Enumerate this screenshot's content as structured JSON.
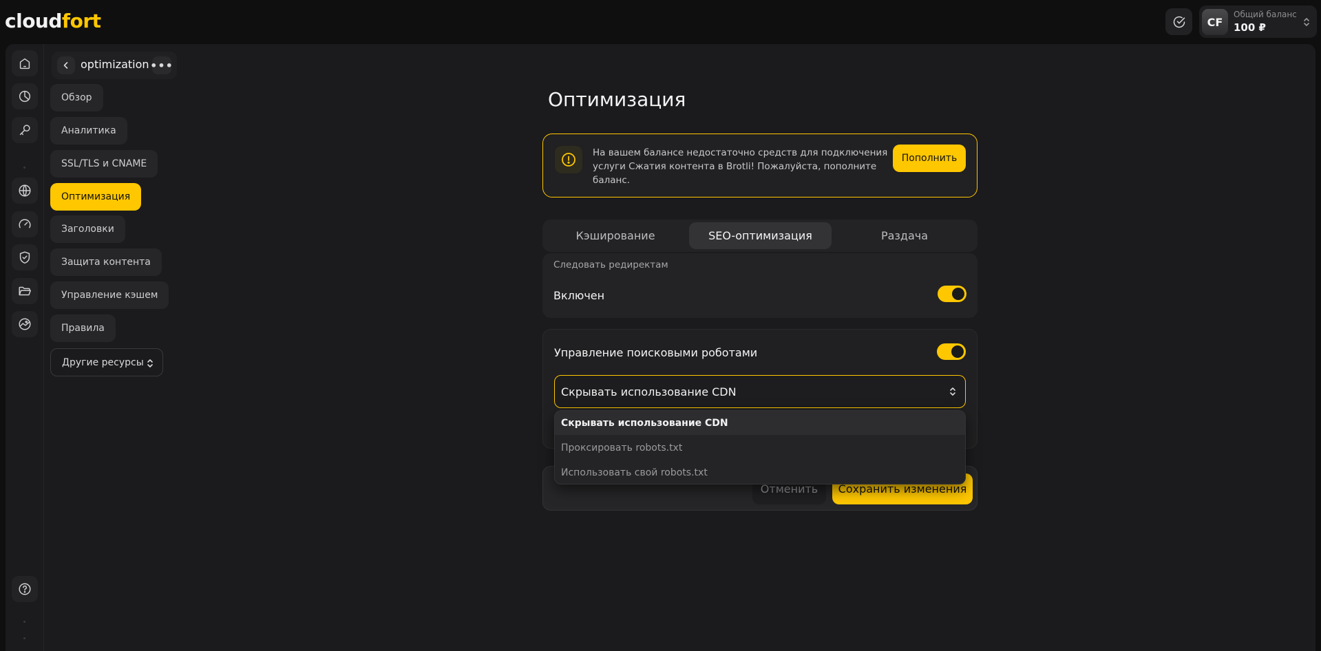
{
  "logo": {
    "part1": "cloud",
    "part2": "fort"
  },
  "header": {
    "avatar_initials": "CF",
    "balance_label": "Общий баланс",
    "balance_value": "100 ₽"
  },
  "icon_sidebar": {
    "items": [
      {
        "icon": "home-icon"
      },
      {
        "icon": "analytics-icon"
      },
      {
        "icon": "key-icon"
      },
      {
        "icon": "globe-icon"
      },
      {
        "icon": "speedometer-icon"
      },
      {
        "icon": "shield-icon"
      },
      {
        "icon": "folder-icon"
      },
      {
        "icon": "image-icon"
      },
      {
        "icon": "help-icon"
      }
    ]
  },
  "nav": {
    "resource_name": "optimization",
    "items": [
      {
        "label": "Обзор"
      },
      {
        "label": "Аналитика"
      },
      {
        "label": "SSL/TLS и CNAME"
      },
      {
        "label": "Оптимизация",
        "active": true
      },
      {
        "label": "Заголовки"
      },
      {
        "label": "Защита контента"
      },
      {
        "label": "Управление кэшем"
      },
      {
        "label": "Правила"
      }
    ],
    "other_resources": "Другие ресурсы"
  },
  "page": {
    "title": "Оптимизация",
    "alert": {
      "text": "На вашем балансе недостаточно средств для подключения услуги Сжатия контента в Brotli! Пожалуйста, пополните баланс.",
      "button": "Пополнить"
    },
    "tabs": [
      {
        "label": "Кэширование"
      },
      {
        "label": "SEO-оптимизация",
        "active": true
      },
      {
        "label": "Раздача"
      }
    ],
    "redirects": {
      "subtitle": "Следовать редиректам",
      "label": "Включен",
      "enabled": true
    },
    "robots": {
      "label": "Управление поисковыми роботами",
      "enabled": true,
      "selected": "Скрывать использование CDN",
      "options": [
        "Скрывать использование CDN",
        "Проксировать robots.txt",
        "Использовать свой robots.txt"
      ]
    },
    "actions": {
      "cancel": "Отменить",
      "save": "Сохранить изменения"
    }
  },
  "colors": {
    "accent": "#ffc700",
    "background": "#0f0f10",
    "panel": "#1b1b1d"
  }
}
